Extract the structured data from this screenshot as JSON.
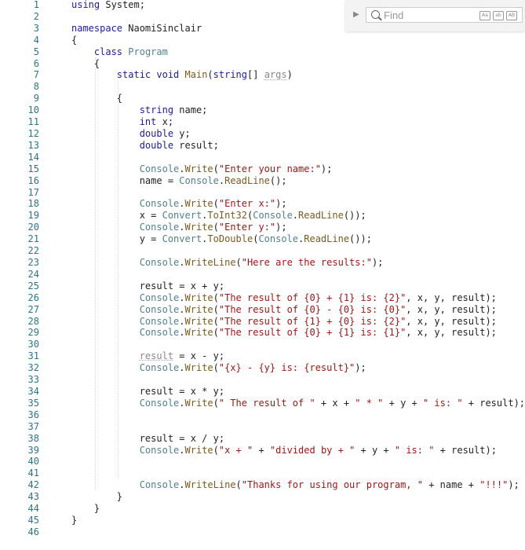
{
  "find_widget": {
    "placeholder": "Find",
    "options": [
      "Aa",
      "ab",
      "AB"
    ],
    "icons": [
      "expand-arrow-icon",
      "search-icon",
      "match-case-icon",
      "whole-word-icon",
      "regex-icon"
    ]
  },
  "colors": {
    "keyword": "#1c1c9c",
    "type": "#4f7f8f",
    "method": "#7a5a1e",
    "string": "#a31515",
    "line_number": "#2b7489"
  },
  "lines": [
    [
      [
        "k",
        "using"
      ],
      [
        "p",
        " System;"
      ]
    ],
    [],
    [
      [
        "k",
        "namespace"
      ],
      [
        "p",
        " NaomiSinclair"
      ]
    ],
    [
      [
        "p",
        "{"
      ]
    ],
    [
      [
        "p",
        "    "
      ],
      [
        "k",
        "class"
      ],
      [
        "p",
        " "
      ],
      [
        "t",
        "Program"
      ]
    ],
    [
      [
        "p",
        "    {"
      ]
    ],
    [
      [
        "p",
        "        "
      ],
      [
        "k",
        "static void"
      ],
      [
        "p",
        " "
      ],
      [
        "m",
        "Main"
      ],
      [
        "p",
        "("
      ],
      [
        "k",
        "string"
      ],
      [
        "p",
        "[] "
      ],
      [
        "a",
        "args"
      ],
      [
        "p",
        ")"
      ]
    ],
    [],
    [
      [
        "p",
        "        {"
      ]
    ],
    [
      [
        "p",
        "            "
      ],
      [
        "k",
        "string"
      ],
      [
        "p",
        " name;"
      ]
    ],
    [
      [
        "p",
        "            "
      ],
      [
        "k",
        "int"
      ],
      [
        "p",
        " x;"
      ]
    ],
    [
      [
        "p",
        "            "
      ],
      [
        "k",
        "double"
      ],
      [
        "p",
        " y;"
      ]
    ],
    [
      [
        "p",
        "            "
      ],
      [
        "k",
        "double"
      ],
      [
        "p",
        " result;"
      ]
    ],
    [],
    [
      [
        "p",
        "            "
      ],
      [
        "t",
        "Console"
      ],
      [
        "p",
        "."
      ],
      [
        "m",
        "Write"
      ],
      [
        "p",
        "("
      ],
      [
        "s",
        "\"Enter your name:\""
      ],
      [
        "p",
        ");"
      ]
    ],
    [
      [
        "p",
        "            name = "
      ],
      [
        "t",
        "Console"
      ],
      [
        "p",
        "."
      ],
      [
        "m",
        "ReadLine"
      ],
      [
        "p",
        "();"
      ]
    ],
    [],
    [
      [
        "p",
        "            "
      ],
      [
        "t",
        "Console"
      ],
      [
        "p",
        "."
      ],
      [
        "m",
        "Write"
      ],
      [
        "p",
        "("
      ],
      [
        "s",
        "\"Enter x:\""
      ],
      [
        "p",
        ");"
      ]
    ],
    [
      [
        "p",
        "            x = "
      ],
      [
        "t",
        "Convert"
      ],
      [
        "p",
        "."
      ],
      [
        "m",
        "ToInt32"
      ],
      [
        "p",
        "("
      ],
      [
        "t",
        "Console"
      ],
      [
        "p",
        "."
      ],
      [
        "m",
        "ReadLine"
      ],
      [
        "p",
        "());"
      ]
    ],
    [
      [
        "p",
        "            "
      ],
      [
        "t",
        "Console"
      ],
      [
        "p",
        "."
      ],
      [
        "m",
        "Write"
      ],
      [
        "p",
        "("
      ],
      [
        "s",
        "\"Enter y:\""
      ],
      [
        "p",
        ");"
      ]
    ],
    [
      [
        "p",
        "            y = "
      ],
      [
        "t",
        "Convert"
      ],
      [
        "p",
        "."
      ],
      [
        "m",
        "ToDouble"
      ],
      [
        "p",
        "("
      ],
      [
        "t",
        "Console"
      ],
      [
        "p",
        "."
      ],
      [
        "m",
        "ReadLine"
      ],
      [
        "p",
        "());"
      ]
    ],
    [],
    [
      [
        "p",
        "            "
      ],
      [
        "t",
        "Console"
      ],
      [
        "p",
        "."
      ],
      [
        "m",
        "WriteLine"
      ],
      [
        "p",
        "("
      ],
      [
        "s",
        "\"Here are the results:\""
      ],
      [
        "p",
        ");"
      ]
    ],
    [],
    [
      [
        "p",
        "            result = x + y;"
      ]
    ],
    [
      [
        "p",
        "            "
      ],
      [
        "t",
        "Console"
      ],
      [
        "p",
        "."
      ],
      [
        "m",
        "Write"
      ],
      [
        "p",
        "("
      ],
      [
        "s",
        "\"The result of {0} + {1} is: {2}\""
      ],
      [
        "p",
        ", x, y, result);"
      ]
    ],
    [
      [
        "p",
        "            "
      ],
      [
        "t",
        "Console"
      ],
      [
        "p",
        "."
      ],
      [
        "m",
        "Write"
      ],
      [
        "p",
        "("
      ],
      [
        "s",
        "\"The result of {0} - {0} is: {0}\""
      ],
      [
        "p",
        ", x, y, result);"
      ]
    ],
    [
      [
        "p",
        "            "
      ],
      [
        "t",
        "Console"
      ],
      [
        "p",
        "."
      ],
      [
        "m",
        "Write"
      ],
      [
        "p",
        "("
      ],
      [
        "s",
        "\"The result of {1} + {0} is: {2}\""
      ],
      [
        "p",
        ", x, y, result);"
      ]
    ],
    [
      [
        "p",
        "            "
      ],
      [
        "t",
        "Console"
      ],
      [
        "p",
        "."
      ],
      [
        "m",
        "Write"
      ],
      [
        "p",
        "("
      ],
      [
        "s",
        "\"The result of {0} + {1} is: {1}\""
      ],
      [
        "p",
        ", x, y, result);"
      ]
    ],
    [],
    [
      [
        "p",
        "            "
      ],
      [
        "a",
        "result"
      ],
      [
        "p",
        " = x - y;"
      ]
    ],
    [
      [
        "p",
        "            "
      ],
      [
        "t",
        "Console"
      ],
      [
        "p",
        "."
      ],
      [
        "m",
        "Write"
      ],
      [
        "p",
        "("
      ],
      [
        "s",
        "\"{x} - {y} is: {result}\""
      ],
      [
        "p",
        ");"
      ]
    ],
    [],
    [
      [
        "p",
        "            result = x * y;"
      ]
    ],
    [
      [
        "p",
        "            "
      ],
      [
        "t",
        "Console"
      ],
      [
        "p",
        "."
      ],
      [
        "m",
        "Write"
      ],
      [
        "p",
        "("
      ],
      [
        "s",
        "\" The result of \""
      ],
      [
        "p",
        " + x + "
      ],
      [
        "s",
        "\" * \""
      ],
      [
        "p",
        " + y + "
      ],
      [
        "s",
        "\" is: \""
      ],
      [
        "p",
        " + result);"
      ]
    ],
    [],
    [],
    [
      [
        "p",
        "            result = x / y;"
      ]
    ],
    [
      [
        "p",
        "            "
      ],
      [
        "t",
        "Console"
      ],
      [
        "p",
        "."
      ],
      [
        "m",
        "Write"
      ],
      [
        "p",
        "("
      ],
      [
        "s",
        "\"x + \""
      ],
      [
        "p",
        " + "
      ],
      [
        "s",
        "\"divided by + \""
      ],
      [
        "p",
        " + y + "
      ],
      [
        "s",
        "\" is: \""
      ],
      [
        "p",
        " + result);"
      ]
    ],
    [],
    [],
    [
      [
        "p",
        "            "
      ],
      [
        "t",
        "Console"
      ],
      [
        "p",
        "."
      ],
      [
        "m",
        "WriteLine"
      ],
      [
        "p",
        "("
      ],
      [
        "s",
        "\"Thanks for using our program, \""
      ],
      [
        "p",
        " + name + "
      ],
      [
        "s",
        "\"!!!\""
      ],
      [
        "p",
        ");"
      ]
    ],
    [
      [
        "p",
        "        }"
      ]
    ],
    [
      [
        "p",
        "    }"
      ]
    ],
    [
      [
        "p",
        "}"
      ]
    ],
    []
  ]
}
